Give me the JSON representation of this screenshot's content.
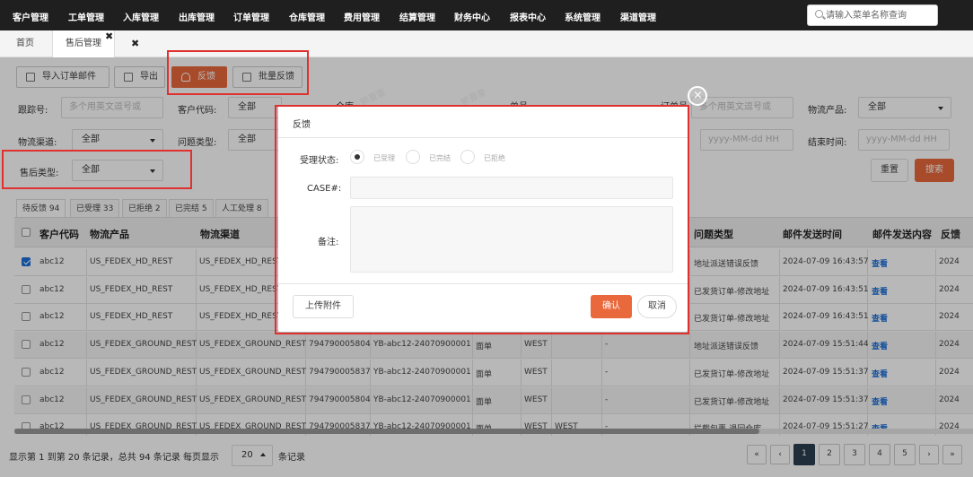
{
  "nav": {
    "menus": [
      "客户管理",
      "工单管理",
      "入库管理",
      "出库管理",
      "订单管理",
      "仓库管理",
      "费用管理",
      "结算管理",
      "财务中心",
      "报表中心",
      "系统管理",
      "渠道管理"
    ],
    "search_placeholder": "请输入菜单名称查询"
  },
  "tabs": {
    "home": "首页",
    "after_sales": "售后管理",
    "tab_close": "✖",
    "close_all": "✖"
  },
  "toolbar": {
    "import_label": "导入订单邮件",
    "export_label": "导出",
    "feedback_label": "反馈",
    "batch_feedback_label": "批量反馈"
  },
  "filters": {
    "tracking_label": "跟踪号:",
    "tracking_placeholder": "多个用英文逗号或",
    "customer_code_label": "客户代码:",
    "customer_code_value": "全部",
    "warehouse_label": "仓库",
    "order_label": "单号",
    "order2_label": "订单号",
    "order2_placeholder": "多个用英文逗号或",
    "product_label": "物流产品:",
    "product_value": "全部",
    "channel_label": "物流渠道:",
    "channel_value": "全部",
    "issue_label": "问题类型:",
    "issue_value": "全部",
    "start_placeholder": "yyyy-MM-dd HH",
    "end_label": "结束时间:",
    "end_placeholder": "yyyy-MM-dd HH",
    "after_sales_type_label": "售后类型:",
    "after_sales_type_value": "全部",
    "reset_label": "重置",
    "search_label": "搜索"
  },
  "status_tabs": [
    "待反馈 94",
    "已受理 33",
    "已拒绝 2",
    "已完结 5",
    "人工处理 8"
  ],
  "table": {
    "left_headers": [
      "客户代码",
      "物流产品",
      "物流渠道"
    ],
    "right_headers": [
      "问题类型",
      "邮件发送时间",
      "邮件发送内容",
      "反馈"
    ],
    "rows": [
      {
        "checked": true,
        "customer": "abc12",
        "product": "US_FEDEX_HD_REST",
        "channel": "US_FEDEX_HD_REST",
        "tracking": "",
        "order": "",
        "type": "",
        "wh": "",
        "wh2": "",
        "dash": "",
        "issue": "地址派送错误反馈",
        "time": "2024-07-09 16:43:57",
        "view": "查看",
        "fb": "2024"
      },
      {
        "checked": false,
        "customer": "abc12",
        "product": "US_FEDEX_HD_REST",
        "channel": "US_FEDEX_HD_REST",
        "tracking": "",
        "order": "",
        "type": "",
        "wh": "",
        "wh2": "",
        "dash": "",
        "issue": "已发货订单-修改地址",
        "time": "2024-07-09 16:43:51",
        "view": "查看",
        "fb": "2024"
      },
      {
        "checked": false,
        "customer": "abc12",
        "product": "US_FEDEX_HD_REST",
        "channel": "US_FEDEX_HD_REST",
        "tracking": "",
        "order": "",
        "type": "",
        "wh": "",
        "wh2": "",
        "dash": "",
        "issue": "已发货订单-修改地址",
        "time": "2024-07-09 16:43:51",
        "view": "查看",
        "fb": "2024"
      },
      {
        "checked": false,
        "customer": "abc12",
        "product": "US_FEDEX_GROUND_REST",
        "channel": "US_FEDEX_GROUND_REST",
        "tracking": "794790005804",
        "order": "YB-abc12-24070900001",
        "type": "面单",
        "wh": "WEST",
        "wh2": "",
        "dash": "-",
        "issue": "地址派送错误反馈",
        "time": "2024-07-09 15:51:44",
        "view": "查看",
        "fb": "2024"
      },
      {
        "checked": false,
        "customer": "abc12",
        "product": "US_FEDEX_GROUND_REST",
        "channel": "US_FEDEX_GROUND_REST",
        "tracking": "794790005837",
        "order": "YB-abc12-24070900001",
        "type": "面单",
        "wh": "WEST",
        "wh2": "",
        "dash": "-",
        "issue": "已发货订单-修改地址",
        "time": "2024-07-09 15:51:37",
        "view": "查看",
        "fb": "2024"
      },
      {
        "checked": false,
        "customer": "abc12",
        "product": "US_FEDEX_GROUND_REST",
        "channel": "US_FEDEX_GROUND_REST",
        "tracking": "794790005804",
        "order": "YB-abc12-24070900001",
        "type": "面单",
        "wh": "WEST",
        "wh2": "",
        "dash": "-",
        "issue": "已发货订单-修改地址",
        "time": "2024-07-09 15:51:37",
        "view": "查看",
        "fb": "2024"
      },
      {
        "checked": false,
        "customer": "abc12",
        "product": "US_FEDEX_GROUND_REST",
        "channel": "US_FEDEX_GROUND_REST",
        "tracking": "794790005837",
        "order": "YB-abc12-24070900001",
        "type": "面单",
        "wh": "WEST",
        "wh2": "WEST",
        "dash": "-",
        "issue": "拦截包裹-退回仓库",
        "time": "2024-07-09 15:51:27",
        "view": "查看",
        "fb": "2024"
      }
    ]
  },
  "pagination": {
    "summary": "显示第 1 到第 20 条记录，总共 94 条记录 每页显示",
    "page_size": "20",
    "suffix": "条记录",
    "first": "«",
    "prev": "‹",
    "pages": [
      "1",
      "2",
      "3",
      "4",
      "5"
    ],
    "next": "›",
    "last": "»"
  },
  "modal": {
    "title": "反馈",
    "status_label": "受理状态:",
    "status_options": [
      "已受理",
      "已完结",
      "已拒绝"
    ],
    "case_label": "CASE#:",
    "remark_label": "备注:",
    "upload_label": "上传附件",
    "confirm_label": "确认",
    "cancel_label": "取消",
    "close_glyph": "×"
  },
  "watermark": "赖晋豪",
  "colors": {
    "accent": "#e9693c",
    "highlight": "#e03030",
    "link": "#1e6fd9"
  }
}
